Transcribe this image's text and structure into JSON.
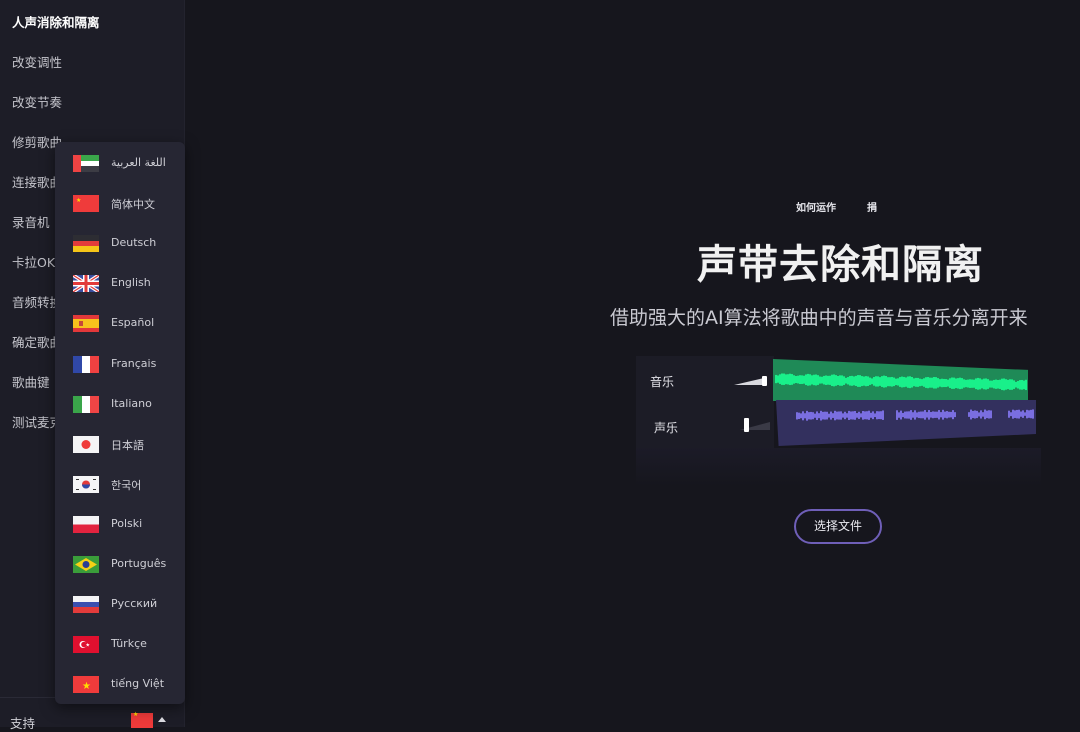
{
  "sidebar": {
    "items": [
      {
        "label": "人声消除和隔离",
        "active": true
      },
      {
        "label": "改变调性"
      },
      {
        "label": "改变节奏"
      },
      {
        "label": "修剪歌曲"
      },
      {
        "label": "连接歌曲"
      },
      {
        "label": "录音机"
      },
      {
        "label": "卡拉OK"
      },
      {
        "label": "音频转换"
      },
      {
        "label": "确定歌曲"
      },
      {
        "label": "歌曲键"
      },
      {
        "label": "测试麦克风"
      }
    ],
    "footer": {
      "support_label": "支持",
      "current_language_flag": "flag-cn-icon"
    }
  },
  "language_menu": {
    "items": [
      {
        "label": "اللغة العربية",
        "flag": "flag-ae-icon"
      },
      {
        "label": "简体中文",
        "flag": "flag-cn-icon"
      },
      {
        "label": "Deutsch",
        "flag": "flag-de-icon"
      },
      {
        "label": "English",
        "flag": "flag-gb-icon"
      },
      {
        "label": "Español",
        "flag": "flag-es-icon"
      },
      {
        "label": "Français",
        "flag": "flag-fr-icon"
      },
      {
        "label": "Italiano",
        "flag": "flag-it-icon"
      },
      {
        "label": "日本語",
        "flag": "flag-jp-icon"
      },
      {
        "label": "한국어",
        "flag": "flag-kr-icon"
      },
      {
        "label": "Polski",
        "flag": "flag-pl-icon"
      },
      {
        "label": "Português",
        "flag": "flag-br-icon"
      },
      {
        "label": "Русский",
        "flag": "flag-ru-icon"
      },
      {
        "label": "Türkçe",
        "flag": "flag-tr-icon"
      },
      {
        "label": "tiếng Việt",
        "flag": "flag-vn-icon"
      }
    ]
  },
  "header": {
    "links": [
      "如何运作",
      "捐"
    ]
  },
  "hero": {
    "title": "声带去除和隔离",
    "subtitle": "借助强大的AI算法将歌曲中的声音与音乐分离开来",
    "demo": {
      "tracks": [
        "音乐",
        "声乐"
      ],
      "music_color": "#19f08a",
      "vocal_color": "#7a6ee0"
    },
    "choose_file_label": "选择文件"
  }
}
